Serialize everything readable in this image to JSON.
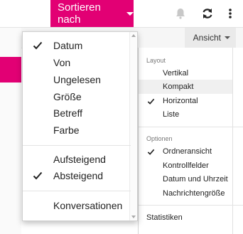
{
  "toolbar": {
    "sort_label": "Sortieren nach",
    "view_label": "Ansicht",
    "accent_color": "#e20074"
  },
  "icons": {
    "bell": "bell-icon",
    "refresh": "refresh-icon",
    "more": "more-vertical-icon",
    "check": "checkmark-icon"
  },
  "sort_menu": {
    "fields": [
      {
        "label": "Datum",
        "checked": true
      },
      {
        "label": "Von",
        "checked": false
      },
      {
        "label": "Ungelesen",
        "checked": false
      },
      {
        "label": "Größe",
        "checked": false
      },
      {
        "label": "Betreff",
        "checked": false
      },
      {
        "label": "Farbe",
        "checked": false
      }
    ],
    "order": [
      {
        "label": "Aufsteigend",
        "checked": false
      },
      {
        "label": "Absteigend",
        "checked": true
      }
    ],
    "conversations": {
      "label": "Konversationen",
      "checked": false
    }
  },
  "view_menu": {
    "layout_heading": "Layout",
    "layout_items": [
      {
        "label": "Vertikal",
        "checked": false
      },
      {
        "label": "Kompakt",
        "checked": false,
        "highlighted": true
      },
      {
        "label": "Horizontal",
        "checked": true
      },
      {
        "label": "Liste",
        "checked": false
      }
    ],
    "options_heading": "Optionen",
    "options_items": [
      {
        "label": "Ordneransicht",
        "checked": true
      },
      {
        "label": "Kontrollfelder",
        "checked": false
      },
      {
        "label": "Datum und Uhrzeit",
        "checked": false
      },
      {
        "label": "Nachrichtengröße",
        "checked": false
      }
    ],
    "statistics_label": "Statistiken"
  }
}
